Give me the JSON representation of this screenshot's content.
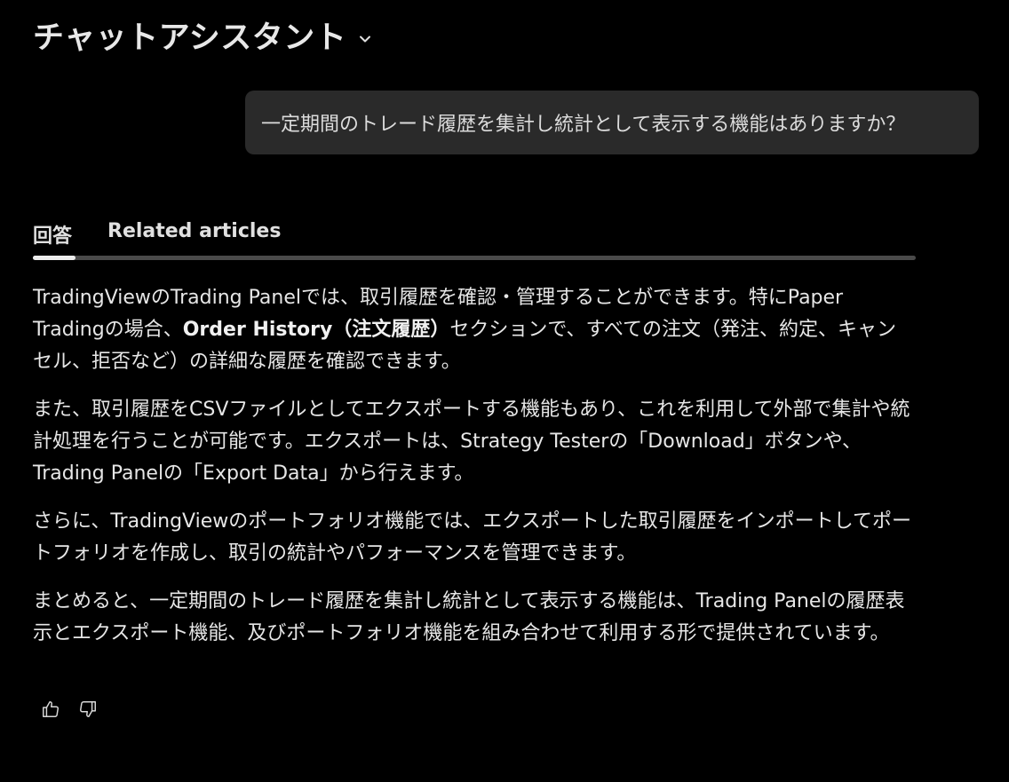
{
  "header": {
    "title": "チャットアシスタント",
    "chevron_icon": "chevron-down-icon"
  },
  "user_message": {
    "text": "一定期間のトレード履歴を集計し統計として表示する機能はありますか？"
  },
  "tabs": [
    {
      "label": "回答",
      "active": true
    },
    {
      "label": "Related articles",
      "active": false
    }
  ],
  "answer": {
    "p1_a": "TradingViewのTrading Panelでは、取引履歴を確認・管理することができます。特にPaper Tradingの場合、",
    "p1_strong": "Order History（注文履歴）",
    "p1_b": "セクションで、すべての注文（発注、約定、キャンセル、拒否など）の詳細な履歴を確認できます。",
    "p2": "また、取引履歴をCSVファイルとしてエクスポートする機能もあり、これを利用して外部で集計や統計処理を行うことが可能です。エクスポートは、Strategy Testerの「Download」ボタンや、Trading Panelの「Export Data」から行えます。",
    "p3": "さらに、TradingViewのポートフォリオ機能では、エクスポートした取引履歴をインポートしてポートフォリオを作成し、取引の統計やパフォーマンスを管理できます。",
    "p4": "まとめると、一定期間のトレード履歴を集計し統計として表示する機能は、Trading Panelの履歴表示とエクスポート機能、及びポートフォリオ機能を組み合わせて利用する形で提供されています。"
  },
  "feedback": {
    "like_icon": "thumbs-up-icon",
    "dislike_icon": "thumbs-down-icon"
  },
  "colors": {
    "background": "#000000",
    "bubble": "#2a2a2a",
    "text": "#e6e6e6",
    "tab_track": "#4a4a4a",
    "tab_indicator": "#ececec"
  }
}
